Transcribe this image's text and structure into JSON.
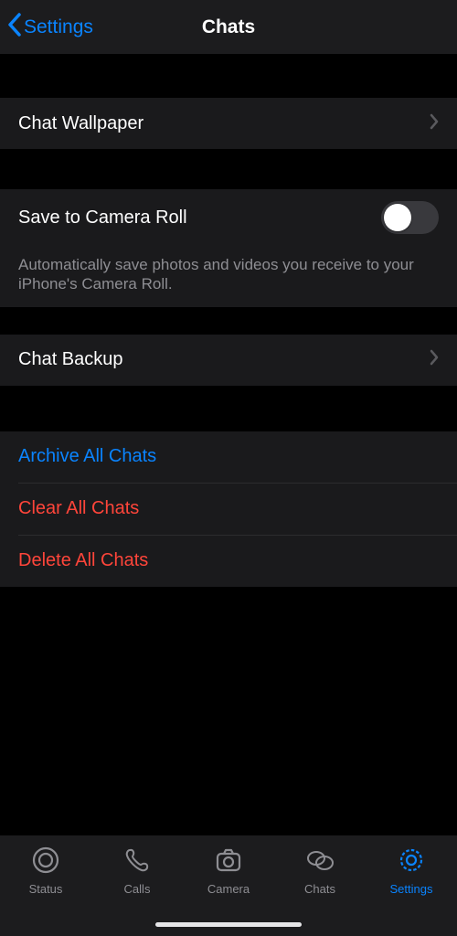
{
  "header": {
    "back_label": "Settings",
    "title": "Chats"
  },
  "rows": {
    "wallpaper": "Chat Wallpaper",
    "save_camera": "Save to Camera Roll",
    "save_camera_footer": "Automatically save photos and videos you receive to your iPhone's Camera Roll.",
    "backup": "Chat Backup",
    "archive": "Archive All Chats",
    "clear": "Clear All Chats",
    "delete": "Delete All Chats"
  },
  "toggles": {
    "save_camera_on": false
  },
  "tabs": {
    "status": "Status",
    "calls": "Calls",
    "camera": "Camera",
    "chats": "Chats",
    "settings": "Settings"
  },
  "colors": {
    "accent": "#0a84ff",
    "danger": "#ff453a",
    "bg_row": "#1a1a1c",
    "bg_header": "#1c1c1e"
  }
}
